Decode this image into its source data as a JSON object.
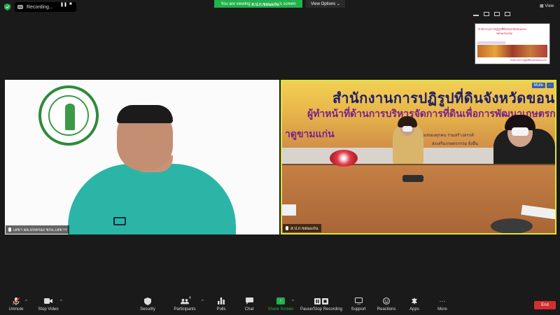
{
  "topbar": {
    "recording_label": "Recording...",
    "pause_glyph": "❚❚",
    "stop_glyph": "■",
    "viewing_prefix": "You are viewing",
    "viewing_name": "ส.ป.ก.ขอนแก่น",
    "viewing_suffix": "'s screen",
    "view_options_label": "View Options",
    "view_label": "View"
  },
  "thumbnail": {
    "title_line1": "สำนักงานการปฏิรูปที่ดินจังหวัดขอนแก่น",
    "title_line2": "ขอนแก่นกลุ่ม",
    "caption": "สำนักงานการปฏิรูปที่ดินจังหวัดขอนแก่น"
  },
  "tiles": {
    "left": {
      "name": "เลขา ผอ.ปกครอง ขกแ.เลขาฯ"
    },
    "right": {
      "name": "ส.ป.ก.ขอนแก่น",
      "mute_label": "Mute",
      "more_label": "···",
      "banner_title": "สำนักงานการปฏิรูปที่ดินจังหวัดขอนแก่น",
      "banner_subtitle": "ผู้ทำหน้าที่ด้านการบริหารจัดการที่ดินเพื่อการพัฒนาเกษตรกร",
      "banner_left": "าดูขามแก่น",
      "banner_small1": "เสียงของทุกคน ร่วมสร้างสรรค์",
      "banner_small2": "ส่งเสริมเกษตรกรรม ยั่งยืน"
    }
  },
  "toolbar": {
    "unmute": "Unmute",
    "stop_video": "Stop Video",
    "security": "Security",
    "participants": "Participants",
    "participants_count": "4",
    "polls": "Polls",
    "chat": "Chat",
    "share_screen": "Share Screen",
    "pause_recording": "Pause/Stop Recording",
    "support": "Support",
    "reactions": "Reactions",
    "apps": "Apps",
    "more": "More",
    "end": "End"
  },
  "colors": {
    "share_green": "#22b14c",
    "end_red": "#d32f2f",
    "active_speaker_border": "#d8e63a",
    "background": "#1a1a1a"
  }
}
